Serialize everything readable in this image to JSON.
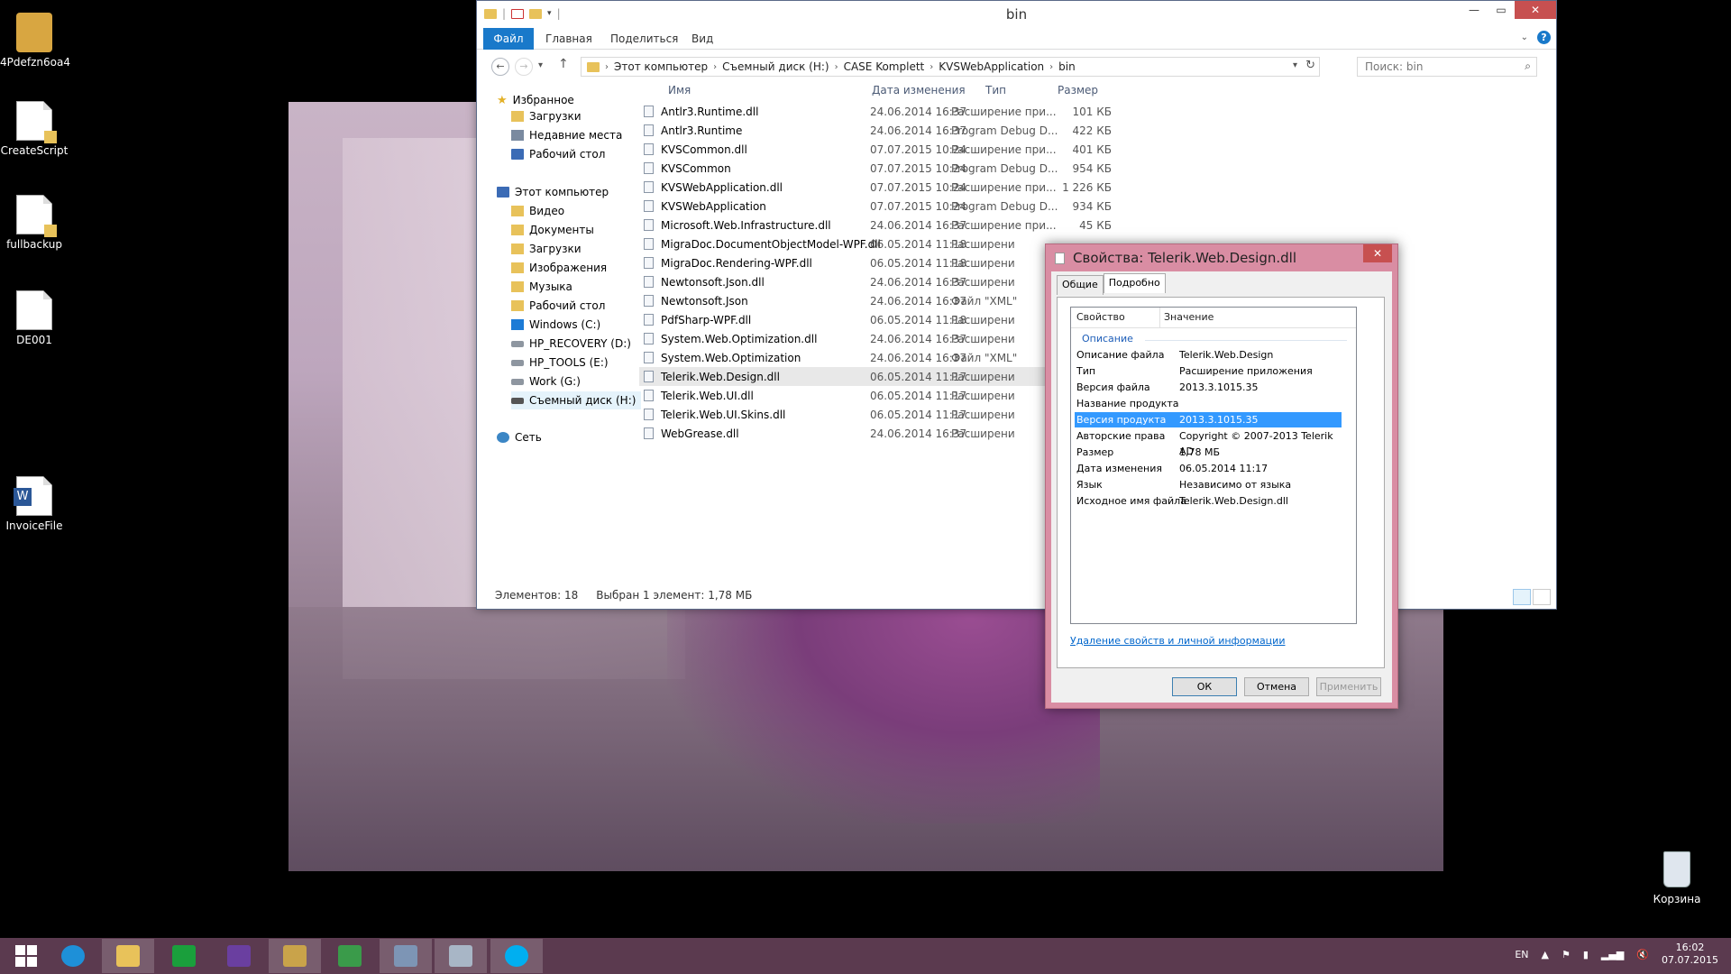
{
  "desktop": {
    "icons": [
      {
        "label": "4Pdefzn6oa4"
      },
      {
        "label": "CreateScript"
      },
      {
        "label": "fullbackup"
      },
      {
        "label": "DE001"
      },
      {
        "label": "InvoiceFile"
      }
    ],
    "recycle_bin": "Корзина"
  },
  "explorer": {
    "title": "bin",
    "ribbon": {
      "file": "Файл",
      "home": "Главная",
      "share": "Поделиться",
      "view": "Вид"
    },
    "address": [
      "Этот компьютер",
      "Съемный диск (H:)",
      "CASE Komplett",
      "KVSWebApplication",
      "bin"
    ],
    "search_placeholder": "Поиск: bin",
    "nav": {
      "favorites": "Избранное",
      "downloads": "Загрузки",
      "recent": "Недавние места",
      "desktop": "Рабочий стол",
      "this_pc": "Этот компьютер",
      "video": "Видео",
      "documents": "Документы",
      "downloads2": "Загрузки",
      "pictures": "Изображения",
      "music": "Музыка",
      "desktop2": "Рабочий стол",
      "windows": "Windows (C:)",
      "hp_recovery": "HP_RECOVERY (D:)",
      "hp_tools": "HP_TOOLS (E:)",
      "work": "Work (G:)",
      "removable": "Съемный диск (H:)",
      "network": "Сеть"
    },
    "columns": {
      "name": "Имя",
      "date": "Дата изменения",
      "type": "Тип",
      "size": "Размер"
    },
    "files": [
      {
        "name": "Antlr3.Runtime.dll",
        "date": "24.06.2014 16:37",
        "type": "Расширение при...",
        "size": "101 КБ"
      },
      {
        "name": "Antlr3.Runtime",
        "date": "24.06.2014 16:37",
        "type": "Program Debug D...",
        "size": "422 КБ"
      },
      {
        "name": "KVSCommon.dll",
        "date": "07.07.2015 10:24",
        "type": "Расширение при...",
        "size": "401 КБ"
      },
      {
        "name": "KVSCommon",
        "date": "07.07.2015 10:24",
        "type": "Program Debug D...",
        "size": "954 КБ"
      },
      {
        "name": "KVSWebApplication.dll",
        "date": "07.07.2015 10:24",
        "type": "Расширение при...",
        "size": "1 226 КБ"
      },
      {
        "name": "KVSWebApplication",
        "date": "07.07.2015 10:24",
        "type": "Program Debug D...",
        "size": "934 КБ"
      },
      {
        "name": "Microsoft.Web.Infrastructure.dll",
        "date": "24.06.2014 16:37",
        "type": "Расширение при...",
        "size": "45 КБ"
      },
      {
        "name": "MigraDoc.DocumentObjectModel-WPF.dll",
        "date": "06.05.2014 11:18",
        "type": "Расширени",
        "size": ""
      },
      {
        "name": "MigraDoc.Rendering-WPF.dll",
        "date": "06.05.2014 11:18",
        "type": "Расширени",
        "size": ""
      },
      {
        "name": "Newtonsoft.Json.dll",
        "date": "24.06.2014 16:37",
        "type": "Расширени",
        "size": ""
      },
      {
        "name": "Newtonsoft.Json",
        "date": "24.06.2014 16:37",
        "type": "Файл \"XML\"",
        "size": ""
      },
      {
        "name": "PdfSharp-WPF.dll",
        "date": "06.05.2014 11:18",
        "type": "Расширени",
        "size": ""
      },
      {
        "name": "System.Web.Optimization.dll",
        "date": "24.06.2014 16:37",
        "type": "Расширени",
        "size": ""
      },
      {
        "name": "System.Web.Optimization",
        "date": "24.06.2014 16:37",
        "type": "Файл \"XML\"",
        "size": ""
      },
      {
        "name": "Telerik.Web.Design.dll",
        "date": "06.05.2014 11:17",
        "type": "Расширени",
        "size": ""
      },
      {
        "name": "Telerik.Web.UI.dll",
        "date": "06.05.2014 11:17",
        "type": "Расширени",
        "size": ""
      },
      {
        "name": "Telerik.Web.UI.Skins.dll",
        "date": "06.05.2014 11:17",
        "type": "Расширени",
        "size": ""
      },
      {
        "name": "WebGrease.dll",
        "date": "24.06.2014 16:37",
        "type": "Расширени",
        "size": ""
      }
    ],
    "status": {
      "count": "Элементов: 18",
      "selected": "Выбран 1 элемент: 1,78 МБ"
    }
  },
  "properties": {
    "title": "Свойства: Telerik.Web.Design.dll",
    "tabs": {
      "general": "Общие",
      "details": "Подробно"
    },
    "col_property": "Свойство",
    "col_value": "Значение",
    "group": "Описание",
    "rows": [
      {
        "k": "Описание файла",
        "v": "Telerik.Web.Design"
      },
      {
        "k": "Тип",
        "v": "Расширение приложения"
      },
      {
        "k": "Версия файла",
        "v": "2013.3.1015.35"
      },
      {
        "k": "Название продукта",
        "v": ""
      },
      {
        "k": "Версия продукта",
        "v": "2013.3.1015.35"
      },
      {
        "k": "Авторские права",
        "v": "Copyright © 2007-2013 Telerik AD"
      },
      {
        "k": "Размер",
        "v": "1,78 МБ"
      },
      {
        "k": "Дата изменения",
        "v": "06.05.2014 11:17"
      },
      {
        "k": "Язык",
        "v": "Независимо от языка"
      },
      {
        "k": "Исходное имя файла",
        "v": "Telerik.Web.Design.dll"
      }
    ],
    "link": "Удаление свойств и личной информации",
    "ok": "ОК",
    "cancel": "Отмена",
    "apply": "Применить"
  },
  "taskbar": {
    "lang": "EN",
    "time": "16:02",
    "date": "07.07.2015"
  }
}
